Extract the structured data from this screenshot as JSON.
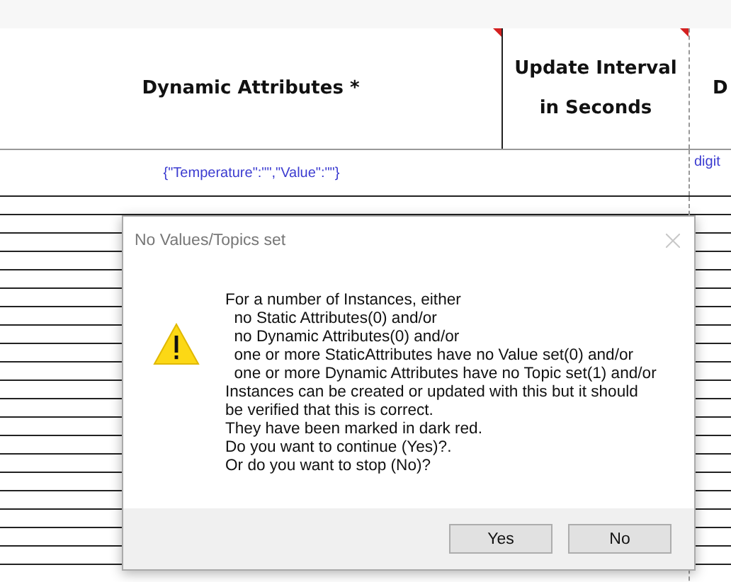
{
  "sheet": {
    "columns": [
      {
        "header": "Dynamic Attributes *",
        "comment": true
      },
      {
        "header": "Update Interval in Seconds",
        "comment": true
      },
      {
        "header": "D",
        "comment": false
      }
    ],
    "rows": [
      {
        "cells": [
          "{\"Temperature\":\"\",\"Value\":\"\"}",
          "",
          "digit"
        ]
      }
    ]
  },
  "dialog": {
    "title": "No Values/Topics set",
    "close_button": {
      "disabled": true
    },
    "message": "For a number of Instances, either\n  no Static Attributes(0) and/or\n  no Dynamic Attributes(0) and/or\n  one or more StaticAttributes have no Value set(0) and/or\n  one or more Dynamic Attributes have no Topic set(1) and/or\nInstances can be created or updated with this but it should\nbe verified that this is correct.\nThey have been marked in dark red.\nDo you want to continue (Yes)?.\nOr do you want to stop (No)?",
    "buttons": [
      "Yes",
      "No"
    ]
  }
}
